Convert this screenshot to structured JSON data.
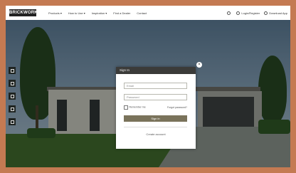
{
  "header": {
    "logo": "BRICKWORKS",
    "nav": [
      "Products ▾",
      "How to Use ▾",
      "Inspiration ▾",
      "Find a Dealer",
      "Contact"
    ],
    "tools": [
      {
        "icon": "search-icon",
        "label": ""
      },
      {
        "icon": "user-icon",
        "label": "Login/Register"
      },
      {
        "icon": "download-icon",
        "label": "Download App"
      }
    ]
  },
  "sidebar": {
    "icons": [
      "layers-icon",
      "image-icon",
      "palette-icon",
      "share-icon",
      "settings-icon"
    ]
  },
  "login": {
    "title": "Sign In",
    "email_placeholder": "Email",
    "password_placeholder": "Password",
    "remember_label": "Remember me",
    "forgot_label": "Forgot password?",
    "login_label": "Sign in",
    "create_label": "Create account"
  },
  "colors": {
    "accent": "#7a735b",
    "frame": "#c47a52"
  }
}
